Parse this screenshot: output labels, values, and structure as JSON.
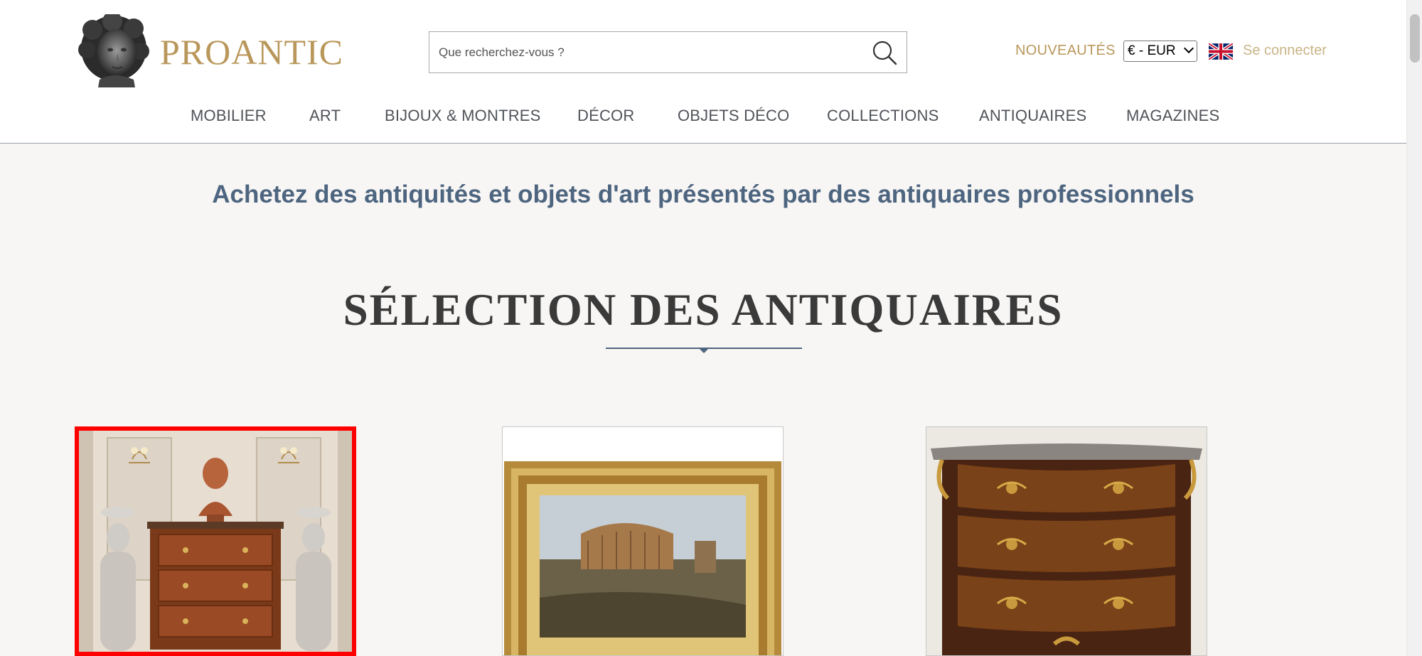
{
  "header": {
    "logo_text": "PROANTIC",
    "search": {
      "placeholder": "Que recherchez-vous ?"
    },
    "nouveautes_label": "NOUVEAUTÉS",
    "currency": {
      "selected": "€ - EUR"
    },
    "login_label": "Se connecter",
    "nav": [
      {
        "label": "MOBILIER"
      },
      {
        "label": "ART"
      },
      {
        "label": "BIJOUX & MONTRES"
      },
      {
        "label": "DÉCOR"
      },
      {
        "label": "OBJETS DÉCO"
      },
      {
        "label": "COLLECTIONS"
      },
      {
        "label": "ANTIQUAIRES"
      },
      {
        "label": "MAGAZINES"
      }
    ]
  },
  "main": {
    "tagline": "Achetez des antiquités et objets d'art présentés par des antiquaires professionnels",
    "section_title": "SÉLECTION DES ANTIQUAIRES"
  },
  "icons": {
    "logo": "bust-sculpture-icon",
    "search": "magnifier-icon",
    "flag": "uk-flag-icon"
  },
  "colors": {
    "brand_gold": "#b9975b",
    "accent_blue": "#4e6580",
    "selected_card_border": "#ff0000",
    "background": "#f7f6f4"
  }
}
